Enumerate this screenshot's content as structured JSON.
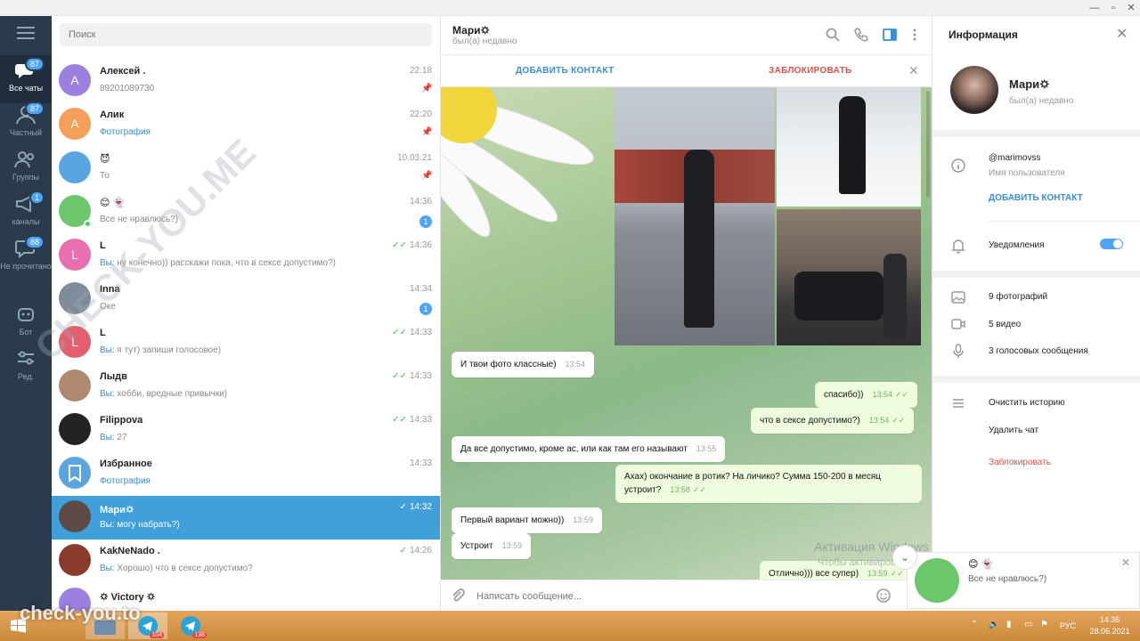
{
  "window": {
    "minimize": "—",
    "maximize": "▫",
    "close": "✕"
  },
  "rail": {
    "folders": [
      {
        "label": "Все чаты",
        "badge": "87",
        "icon": "chats-icon"
      },
      {
        "label": "Частный",
        "badge": "87",
        "icon": "person-icon"
      },
      {
        "label": "Группы",
        "badge": "",
        "icon": "group-icon"
      },
      {
        "label": "каналы",
        "badge": "1",
        "icon": "megaphone-icon"
      },
      {
        "label": "Не прочитано",
        "badge": "88",
        "icon": "unread-icon"
      },
      {
        "label": "Бот",
        "badge": "",
        "icon": "bot-icon"
      },
      {
        "label": "Ред.",
        "badge": "",
        "icon": "sliders-icon"
      }
    ]
  },
  "chatlist": {
    "search_placeholder": "Поиск",
    "chats": [
      {
        "name": "Алексей .",
        "time": "22:18",
        "you": "",
        "preview": "89201089730",
        "pinned": true,
        "initial": "А",
        "color": "#9c80e0"
      },
      {
        "name": "Алик",
        "time": "22:20",
        "you": "",
        "preview": "Фотография",
        "pinned": true,
        "initial": "А",
        "color": "#f5a05a"
      },
      {
        "name": "😈",
        "time": "10.03.21",
        "you": "",
        "preview": "То",
        "pinned": true,
        "initial": "",
        "color": "#5aa5e0"
      },
      {
        "name": "😊 👻",
        "time": "14:36",
        "you": "",
        "preview": "Все не нравлюсь?)",
        "unread": "1",
        "initial": "",
        "color": "#6cc76c"
      },
      {
        "name": "L",
        "time": "14:36",
        "you": "Вы: ",
        "preview": "ну конечно)) расскажи пока, что в сексе допустимо?)",
        "initial": "L",
        "color": "#e86fb0"
      },
      {
        "name": "Inna",
        "time": "14:34",
        "you": "",
        "preview": "Оке",
        "unread": "1",
        "initial": "",
        "color": "#7f8c99"
      },
      {
        "name": "L",
        "time": "14:33",
        "you": "Вы: ",
        "preview": "я тут) запиши голосовое)",
        "initial": "L",
        "color": "#e35f6e"
      },
      {
        "name": "Лыдв",
        "time": "14:33",
        "you": "Вы: ",
        "preview": "хобби, вредные привычки)",
        "initial": "",
        "color": "#b08a70"
      },
      {
        "name": "Filippova",
        "time": "14:33",
        "you": "Вы: ",
        "preview": "27",
        "initial": "",
        "color": "#222222"
      },
      {
        "name": "Избранное",
        "time": "14:33",
        "you": "",
        "preview": "Фотография",
        "initial": "",
        "color": "#5aa5e0"
      },
      {
        "name": "Мари🌣",
        "time": "14:32",
        "you": "Вы: ",
        "preview": "могу набрать?)",
        "initial": "",
        "color": "#5b4a48"
      },
      {
        "name": "KakNeNado .",
        "time": "14:26",
        "you": "Вы: ",
        "preview": "Хорошо) что в сексе допустимо?",
        "initial": "",
        "color": "#8a3a2a"
      },
      {
        "name": "🌣 Victory 🌣",
        "time": "",
        "you": "",
        "preview": "",
        "initial": "",
        "color": "#9c80e0"
      }
    ]
  },
  "conversation": {
    "name": "Мари🌣",
    "status": "был(а) недавно",
    "add_contact": "ДОБАВИТЬ КОНТАКТ",
    "block": "ЗАБЛОКИРОВАТЬ",
    "composer_placeholder": "Написать сообщение...",
    "messages": [
      {
        "text": "И твои фото классные)",
        "time": "13:54",
        "out": false
      },
      {
        "text": "спасибо))",
        "time": "13:54",
        "out": true
      },
      {
        "text": "что в сексе допустимо?)",
        "time": "13:54",
        "out": true
      },
      {
        "text": "Да все допустимо, кроме ас, или как там его называют",
        "time": "13:55",
        "out": false
      },
      {
        "text": "Ахах) окончание в ротик? На личико? Сумма 150-200 в месяц устроит?",
        "time": "13:58",
        "out": true
      },
      {
        "text": "Первый вариант можно))",
        "time": "13:59",
        "out": false
      },
      {
        "text": "Устроит",
        "time": "13:59",
        "out": false
      },
      {
        "text": "Отлично))) все супер)",
        "time": "13:59",
        "out": true
      }
    ]
  },
  "info": {
    "title": "Информация",
    "name": "Мари🌣",
    "status": "был(а) недавно",
    "username": "@marimovss",
    "username_label": "Имя пользователя",
    "add_contact": "ДОБАВИТЬ КОНТАКТ",
    "notifications": "Уведомления",
    "photos": "9 фотографий",
    "videos": "5 видео",
    "voice": "3 голосовых сообщения",
    "clear_history": "Очистить историю",
    "delete_chat": "Удалить чат",
    "block": "Заблокировать",
    "notifications_on": true
  },
  "notification": {
    "title": "😊 👻",
    "text": "Все не нравлюсь?)"
  },
  "overlay": {
    "activation_title": "Активация Windows",
    "activation_text": "Чтобы активировать Windows, перейдите к параметрам",
    "watermark": "CHECK-YOU.ME",
    "watermark_bottom": "check-you.to"
  },
  "taskbar": {
    "lang": "РУС",
    "time": "14:36",
    "date": "28.06.2021",
    "badges": [
      "104",
      "138"
    ]
  },
  "colors": {
    "rail_bg": "#2b3b4e",
    "accent": "#419fd9",
    "badge": "#4ea4f6",
    "danger": "#d9534f",
    "outgoing": "#effdde"
  }
}
